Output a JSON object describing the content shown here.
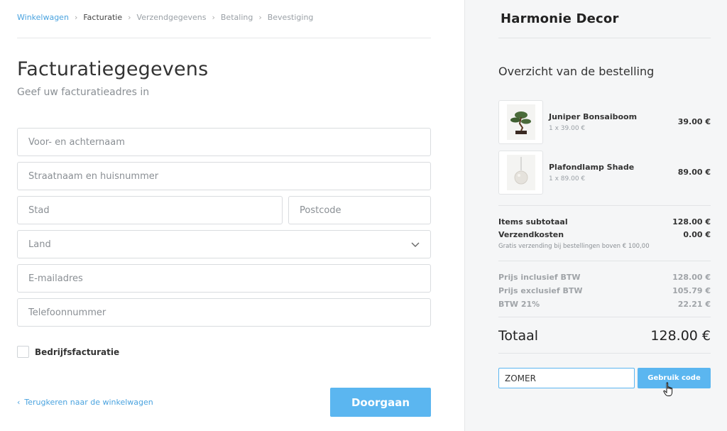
{
  "breadcrumb": {
    "items": [
      "Winkelwagen",
      "Facturatie",
      "Verzendgegevens",
      "Betaling",
      "Bevestiging"
    ],
    "separator": "›"
  },
  "form": {
    "title": "Facturatiegegevens",
    "subtitle": "Geef uw facturatieadres in",
    "fields": {
      "name": {
        "placeholder": "Voor- en achternaam",
        "value": ""
      },
      "street": {
        "placeholder": "Straatnaam en huisnummer",
        "value": ""
      },
      "city": {
        "placeholder": "Stad",
        "value": ""
      },
      "postcode": {
        "placeholder": "Postcode",
        "value": ""
      },
      "country": {
        "selected": "Land"
      },
      "email": {
        "placeholder": "E-mailadres",
        "value": ""
      },
      "phone": {
        "placeholder": "Telefoonnummer",
        "value": ""
      }
    },
    "business_checkbox": {
      "label": "Bedrijfsfacturatie",
      "checked": false
    },
    "back_link": "Terugkeren naar de winkelwagen",
    "continue_label": "Doorgaan"
  },
  "summary": {
    "brand": "Harmonie Decor",
    "title": "Overzicht van de bestelling",
    "items": [
      {
        "name": "Juniper Bonsaiboom",
        "qty": "1 x 39.00 €",
        "price": "39.00 €"
      },
      {
        "name": "Plafondlamp Shade",
        "qty": "1 x 89.00 €",
        "price": "89.00 €"
      }
    ],
    "subtotal_label": "Items subtotaal",
    "subtotal": "128.00 €",
    "shipping_label": "Verzendkosten",
    "shipping": "0.00 €",
    "shipping_note": "Gratis verzending bij bestellingen boven € 100,00",
    "incl_label": "Prijs inclusief BTW",
    "incl": "128.00 €",
    "excl_label": "Prijs exclusief BTW",
    "excl": "105.79 €",
    "vat_label": "BTW 21%",
    "vat": "22.21 €",
    "total_label": "Totaal",
    "total": "128.00 €",
    "coupon_value": "ZOMER",
    "coupon_button": "Gebruik code"
  },
  "colors": {
    "accent": "#5bb6f0",
    "link": "#4aa3df",
    "panel_bg": "#f5f6f7"
  }
}
